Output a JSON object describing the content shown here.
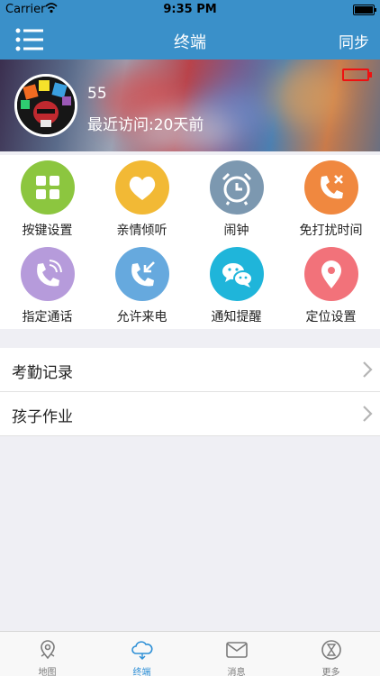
{
  "status_bar": {
    "carrier": "Carrier",
    "time": "9:35 PM"
  },
  "nav": {
    "title": "终端",
    "sync": "同步",
    "menu_icon": "list-icon"
  },
  "device": {
    "name": "55",
    "last_visit": "最近访问:20天前",
    "battery_status": "low"
  },
  "grid": [
    {
      "label": "按键设置",
      "icon": "keypad-grid-icon",
      "color": "#8cc63f"
    },
    {
      "label": "亲情倾听",
      "icon": "heart-icon",
      "color": "#f2b935"
    },
    {
      "label": "闹钟",
      "icon": "alarm-clock-icon",
      "color": "#7c98b0"
    },
    {
      "label": "免打扰时间",
      "icon": "phone-block-icon",
      "color": "#f0883f"
    },
    {
      "label": "指定通话",
      "icon": "phone-call-icon",
      "color": "#b69bdb"
    },
    {
      "label": "允许来电",
      "icon": "incoming-call-icon",
      "color": "#66a9de"
    },
    {
      "label": "通知提醒",
      "icon": "chat-bubbles-icon",
      "color": "#1fb5da"
    },
    {
      "label": "定位设置",
      "icon": "location-pin-icon",
      "color": "#f2727a"
    }
  ],
  "list": [
    {
      "label": "考勤记录"
    },
    {
      "label": "孩子作业"
    }
  ],
  "tabs": [
    {
      "label": "地图",
      "icon": "map-pin-icon"
    },
    {
      "label": "终端",
      "icon": "cloud-icon",
      "active": true
    },
    {
      "label": "消息",
      "icon": "envelope-icon"
    },
    {
      "label": "更多",
      "icon": "hourglass-icon"
    }
  ],
  "colors": {
    "nav_bar": "#3a90c9",
    "active_tab": "#2d8fd6",
    "low_battery": "#e11111"
  }
}
